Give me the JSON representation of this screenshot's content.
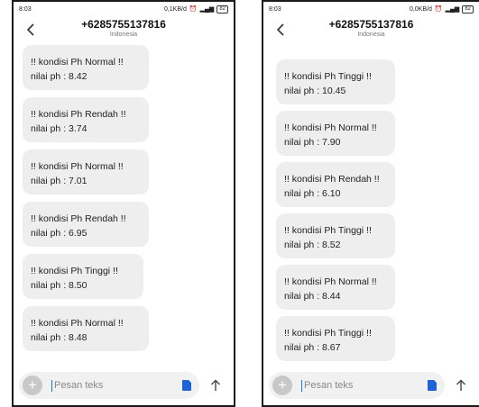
{
  "screens": [
    {
      "status": {
        "time": "8:03",
        "network": "0,1KB/d",
        "battery": "82"
      },
      "header": {
        "number": "+6285755137816",
        "country": "Indonesia"
      },
      "messages": [
        {
          "line1": "!! kondisi Ph Normal !!",
          "line2": "nilai ph : 8.42"
        },
        {
          "line1": "!! kondisi Ph Rendah !!",
          "line2": "nilai ph : 3.74"
        },
        {
          "line1": "!! kondisi Ph Normal !!",
          "line2": "nilai ph : 7.01"
        },
        {
          "line1": "!! kondisi Ph Rendah !!",
          "line2": "nilai ph : 6.95"
        },
        {
          "line1": "!! kondisi Ph Tinggi !!",
          "line2": "nilai ph : 8.50"
        },
        {
          "line1": "!! kondisi Ph Normal !!",
          "line2": "nilai ph : 8.48"
        }
      ],
      "composer": {
        "placeholder": "Pesan teks"
      }
    },
    {
      "status": {
        "time": "8:03",
        "network": "0,0KB/d",
        "battery": "82"
      },
      "header": {
        "number": "+6285755137816",
        "country": "Indonesia"
      },
      "messages": [
        {
          "line1": "!! kondisi Ph Tinggi !!",
          "line2": "nilai ph : 10.45"
        },
        {
          "line1": "!! kondisi Ph Normal !!",
          "line2": "nilai ph : 7.90"
        },
        {
          "line1": "!! kondisi Ph Rendah !!",
          "line2": "nilai ph : 6.10"
        },
        {
          "line1": "!! kondisi Ph Tinggi !!",
          "line2": "nilai ph : 8.52"
        },
        {
          "line1": "!! kondisi Ph Normal !!",
          "line2": "nilai ph : 8.44"
        },
        {
          "line1": "!! kondisi Ph Tinggi !!",
          "line2": "nilai ph : 8.67"
        }
      ],
      "composer": {
        "placeholder": "Pesan teks"
      }
    }
  ],
  "colors": {
    "bubble": "#eeeeee",
    "accent": "#1976d2",
    "sim": "#1e63d6"
  },
  "icons": {
    "back": "arrow-left-icon",
    "add": "plus-icon",
    "sim": "sim-card-icon",
    "send": "arrow-up-icon",
    "signal": "signal-icon",
    "alarm": "alarm-icon"
  }
}
